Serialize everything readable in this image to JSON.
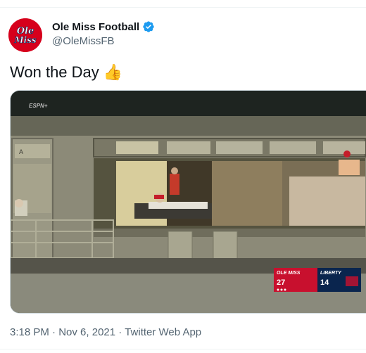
{
  "tweet": {
    "display_name": "Ole Miss Football",
    "handle": "@OleMissFB",
    "verified": true,
    "avatar_text": "Ole Miss",
    "text": "Won the Day",
    "emoji": "thumbs-up-icon",
    "time": "3:18 PM",
    "separator": "·",
    "date": "Nov 6, 2021",
    "source": "Twitter Web App"
  },
  "media": {
    "watermark": "ESPN+",
    "scorebug": {
      "team1_name": "OLE MISS",
      "team1_score": "27",
      "team2_name": "LIBERTY",
      "team2_score": "14"
    }
  },
  "colors": {
    "brand_red": "#d6001c",
    "verified_blue": "#1d9bf0",
    "secondary_text": "#536471",
    "liberty_blue": "#0a254e"
  }
}
